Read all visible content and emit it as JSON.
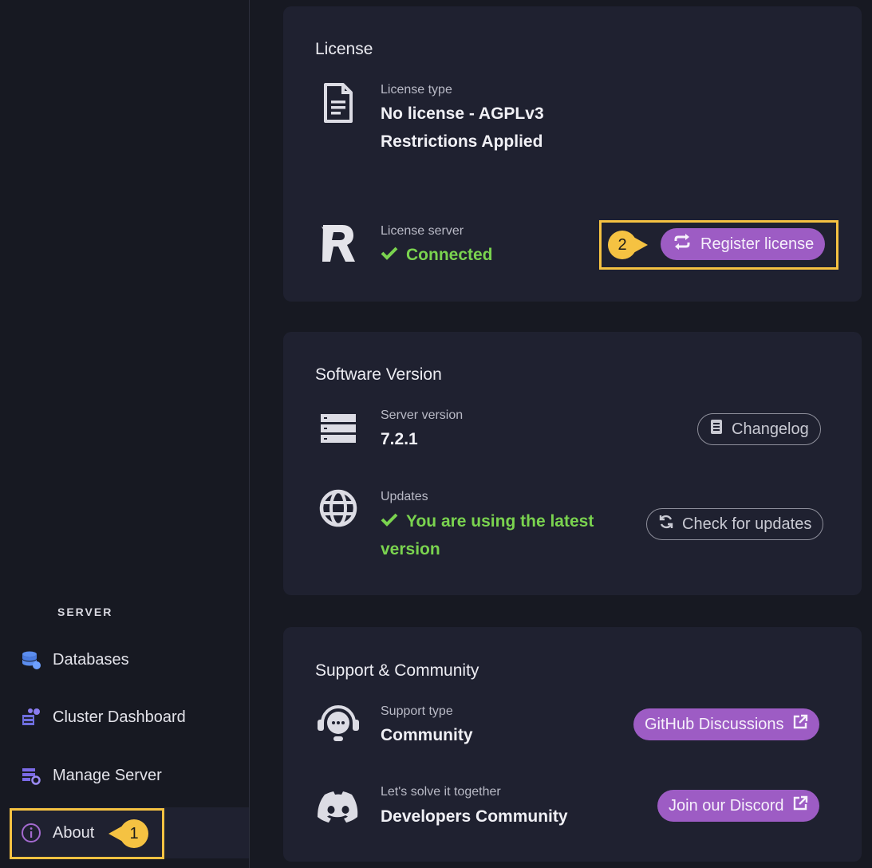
{
  "sidebar": {
    "section_label": "SERVER",
    "items": [
      {
        "label": "Databases",
        "icon": "database-icon"
      },
      {
        "label": "Cluster Dashboard",
        "icon": "cluster-dashboard-icon"
      },
      {
        "label": "Manage Server",
        "icon": "manage-server-icon"
      },
      {
        "label": "About",
        "icon": "info-icon"
      }
    ]
  },
  "callouts": {
    "one": "1",
    "two": "2"
  },
  "license": {
    "title": "License",
    "type_label": "License type",
    "type_value_line1": "No license - AGPLv3",
    "type_value_line2": "Restrictions Applied",
    "server_label": "License server",
    "server_value": "Connected",
    "register_button": "Register license"
  },
  "software": {
    "title": "Software Version",
    "server_version_label": "Server version",
    "server_version_value": "7.2.1",
    "changelog_button": "Changelog",
    "updates_label": "Updates",
    "updates_value_line1": "You are using the latest",
    "updates_value_line2": "version",
    "check_updates_button": "Check for updates"
  },
  "support": {
    "title": "Support & Community",
    "support_type_label": "Support type",
    "support_type_value": "Community",
    "github_button": "GitHub Discussions",
    "discord_label": "Let's solve it together",
    "discord_value": "Developers Community",
    "discord_button": "Join our Discord"
  },
  "colors": {
    "accent": "#9d5cc4",
    "success": "#7ad34f",
    "highlight": "#f5c242",
    "background": "#171922",
    "card": "#1f2130"
  }
}
